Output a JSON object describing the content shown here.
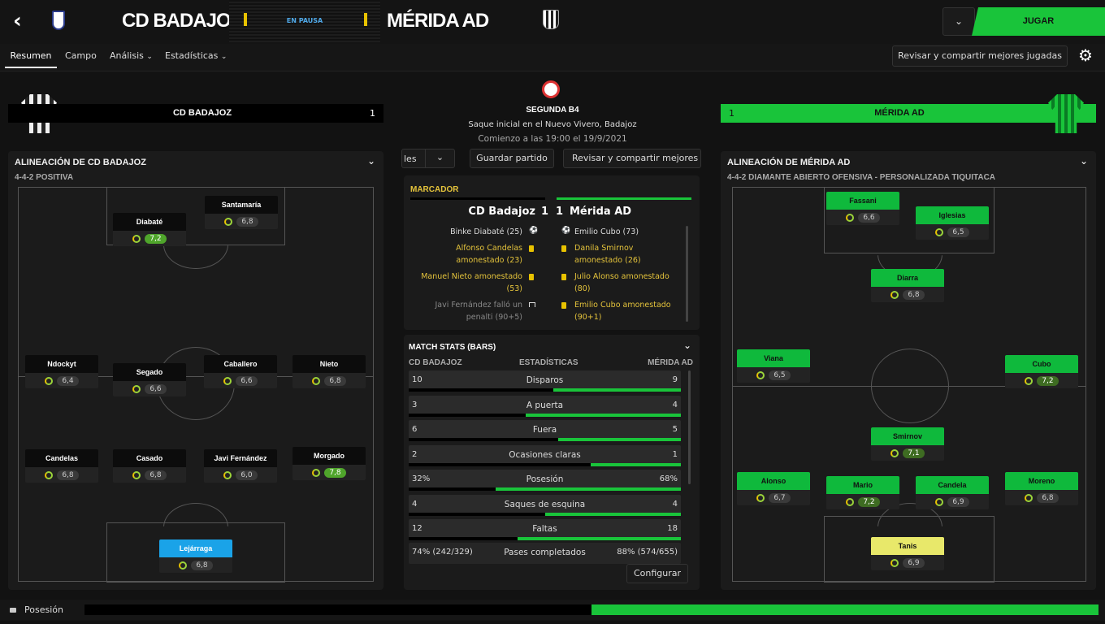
{
  "header": {
    "home_team": "CD BADAJOZ",
    "away_team": "MÉRIDA AD",
    "status": "EN PAUSA",
    "play_label": "JUGAR"
  },
  "nav": {
    "tabs": [
      "Resumen",
      "Campo",
      "Análisis",
      "Estadísticas"
    ],
    "share_label": "Revisar y compartir mejores jugadas"
  },
  "home_bar": {
    "name": "CD BADAJOZ",
    "score": "1"
  },
  "away_bar": {
    "name": "MÉRIDA AD",
    "score": "1"
  },
  "match_info": {
    "competition": "SEGUNDA B4",
    "kickoff": "Saque inicial en el Nuevo Vivero, Badajoz",
    "start": "Comienzo a las 19:00 el 19/9/2021",
    "dropdown_label": "les",
    "save_label": "Guardar partido",
    "share_label": "Revisar y compartir mejores ju"
  },
  "home_lineup": {
    "title": "ALINEACIÓN DE CD BADAJOZ",
    "formation": "4-4-2 POSITIVA",
    "players": [
      {
        "name": "Santamaría",
        "rating": "6,8",
        "style": "dark",
        "hi": ""
      },
      {
        "name": "Diabaté",
        "rating": "7,2",
        "style": "dark",
        "hi": "hi"
      },
      {
        "name": "Ndockyt",
        "rating": "6,4",
        "style": "dark",
        "hi": ""
      },
      {
        "name": "Segado",
        "rating": "6,6",
        "style": "dark",
        "hi": ""
      },
      {
        "name": "Caballero",
        "rating": "6,6",
        "style": "dark",
        "hi": ""
      },
      {
        "name": "Nieto",
        "rating": "6,8",
        "style": "dark",
        "hi": ""
      },
      {
        "name": "Candelas",
        "rating": "6,8",
        "style": "dark",
        "hi": ""
      },
      {
        "name": "Casado",
        "rating": "6,8",
        "style": "dark",
        "hi": ""
      },
      {
        "name": "Javi Fernández",
        "rating": "6,0",
        "style": "dark",
        "hi": ""
      },
      {
        "name": "Morgado",
        "rating": "7,8",
        "style": "dark",
        "hi": "hi"
      },
      {
        "name": "Lejárraga",
        "rating": "6,8",
        "style": "blue",
        "hi": ""
      }
    ]
  },
  "away_lineup": {
    "title": "ALINEACIÓN DE MÉRIDA AD",
    "formation": "4-4-2 DIAMANTE ABIERTO OFENSIVA - PERSONALIZADA TIQUITACA",
    "players": [
      {
        "name": "Fassani",
        "rating": "6,6",
        "style": "green",
        "hi": ""
      },
      {
        "name": "Iglesias",
        "rating": "6,5",
        "style": "green",
        "hi": ""
      },
      {
        "name": "Diarra",
        "rating": "6,8",
        "style": "green",
        "hi": ""
      },
      {
        "name": "Viana",
        "rating": "6,5",
        "style": "green",
        "hi": ""
      },
      {
        "name": "Cubo",
        "rating": "7,2",
        "style": "green",
        "hi": "mid"
      },
      {
        "name": "Smirnov",
        "rating": "7,1",
        "style": "green",
        "hi": "mid"
      },
      {
        "name": "Alonso",
        "rating": "6,7",
        "style": "green",
        "hi": ""
      },
      {
        "name": "Mario",
        "rating": "7,2",
        "style": "green",
        "hi": "mid"
      },
      {
        "name": "Candela",
        "rating": "6,9",
        "style": "green",
        "hi": ""
      },
      {
        "name": "Moreno",
        "rating": "6,8",
        "style": "green",
        "hi": ""
      },
      {
        "name": "Tanis",
        "rating": "6,9",
        "style": "yellow",
        "hi": ""
      }
    ]
  },
  "scoreboard": {
    "title": "MARCADOR",
    "home": "CD Badajoz",
    "home_score": "1",
    "away_score": "1",
    "away": "Mérida AD",
    "home_events": [
      {
        "text": "Binke Diabaté (25)",
        "type": "goal"
      },
      {
        "text": "Alfonso Candelas amonestado (23)",
        "type": "yellow"
      },
      {
        "text": "Manuel Nieto amonestado (53)",
        "type": "yellow"
      },
      {
        "text": "Javi Fernández falló un penalti (90+5)",
        "type": "miss"
      }
    ],
    "away_events": [
      {
        "text": "Emilio Cubo (73)",
        "type": "goal"
      },
      {
        "text": "Danila Smirnov amonestado (26)",
        "type": "yellow"
      },
      {
        "text": "Julio Alonso amonestado (80)",
        "type": "yellow"
      },
      {
        "text": "Emilio Cubo amonestado (90+1)",
        "type": "yellow"
      }
    ]
  },
  "match_stats": {
    "title": "MATCH STATS (BARS)",
    "col_home": "CD BADAJOZ",
    "col_mid": "ESTADÍSTICAS",
    "col_away": "MÉRIDA AD",
    "rows": [
      {
        "label": "Disparos",
        "home": "10",
        "away": "9",
        "home_frac": 0.53,
        "away_frac": 0.47
      },
      {
        "label": "A puerta",
        "home": "3",
        "away": "4",
        "home_frac": 0.43,
        "away_frac": 0.57
      },
      {
        "label": "Fuera",
        "home": "6",
        "away": "5",
        "home_frac": 0.55,
        "away_frac": 0.45
      },
      {
        "label": "Ocasiones claras",
        "home": "2",
        "away": "1",
        "home_frac": 0.67,
        "away_frac": 0.33
      },
      {
        "label": "Posesión",
        "home": "32%",
        "away": "68%",
        "home_frac": 0.32,
        "away_frac": 0.68
      },
      {
        "label": "Saques de esquina",
        "home": "4",
        "away": "4",
        "home_frac": 0.5,
        "away_frac": 0.5
      },
      {
        "label": "Faltas",
        "home": "12",
        "away": "18",
        "home_frac": 0.4,
        "away_frac": 0.6
      }
    ],
    "passes": {
      "label": "Pases completados",
      "home": "74% (242/329)",
      "away": "88% (574/655)"
    },
    "config_label": "Configurar"
  },
  "possession_bar": {
    "label": "Posesión",
    "home_frac": 0.5,
    "away_frac": 0.5
  },
  "colors": {
    "accent": "#19c43a",
    "yellow": "#e4c33b",
    "blue": "#1aa3e8"
  }
}
